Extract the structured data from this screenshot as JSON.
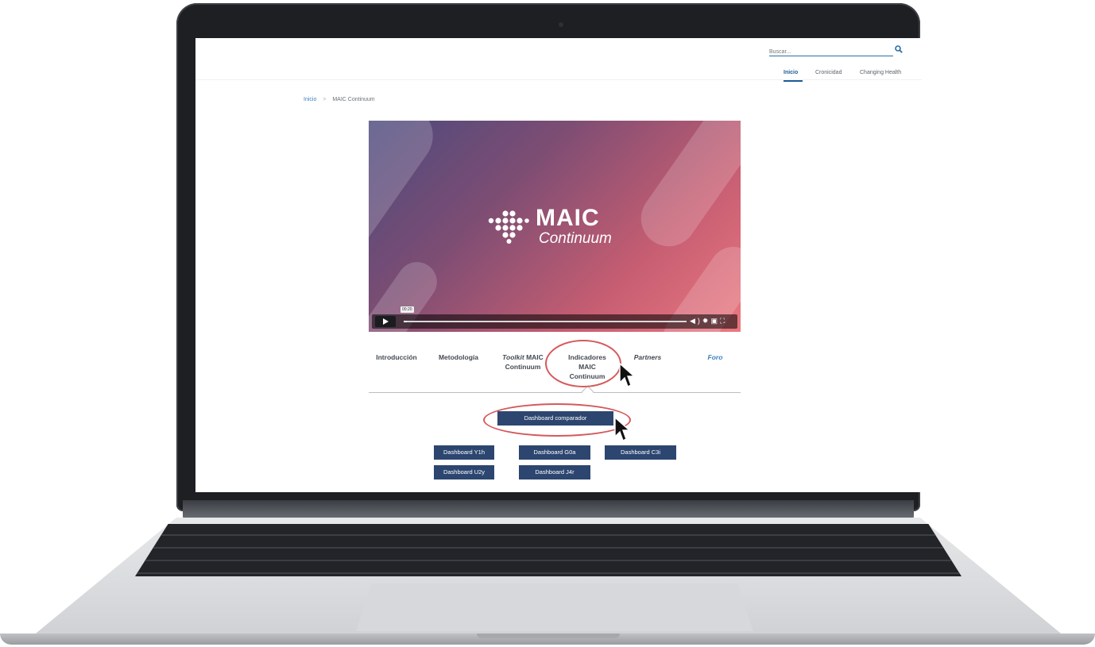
{
  "search": {
    "placeholder": "Buscar..."
  },
  "nav": {
    "items": [
      "Inicio",
      "Cronicidad",
      "Changing Health"
    ]
  },
  "breadcrumb": {
    "home": "Inicio",
    "separator": ">",
    "current": "MAIC Continuum"
  },
  "video": {
    "logo_title": "MAIC",
    "logo_subtitle": "Continuum",
    "time": "00:20",
    "icons": [
      "play-icon",
      "volume-icon",
      "settings-icon",
      "pip-icon",
      "fullscreen-icon"
    ]
  },
  "tabs": [
    {
      "line1": "Introducción"
    },
    {
      "line1": "Metodología"
    },
    {
      "line1a": "Toolkit",
      "line1b": " MAIC",
      "line2": "Continuum"
    },
    {
      "line1": "Indicadores",
      "line2": "MAIC",
      "line3": "Continuum"
    },
    {
      "line1": "Partners"
    },
    {
      "line1": "Foro"
    }
  ],
  "dashboards": {
    "main": "Dashboard comparador",
    "items": [
      "Dashboard Y1h",
      "Dashboard G0a",
      "Dashboard C3i",
      "Dashboard U2y",
      "Dashboard J4r"
    ]
  },
  "colors": {
    "accent": "#2c4670",
    "highlight_ring": "#d45a5c",
    "link": "#3b82c4"
  }
}
